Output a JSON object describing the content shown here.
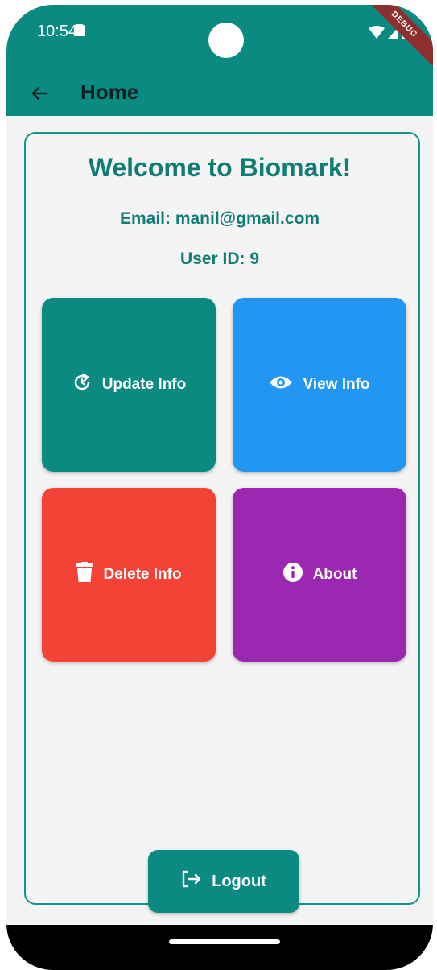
{
  "status_bar": {
    "time": "10:54",
    "debug_label": "DEBUG"
  },
  "app_bar": {
    "title": "Home"
  },
  "main": {
    "welcome": "Welcome to Biomark!",
    "email": "Email: manil@gmail.com",
    "user_id": "User ID: 9"
  },
  "tiles": {
    "update": {
      "label": "Update Info",
      "icon": "refresh-icon",
      "color": "#0b8a82"
    },
    "view": {
      "label": "View Info",
      "icon": "eye-icon",
      "color": "#2196f3"
    },
    "delete": {
      "label": "Delete Info",
      "icon": "trash-icon",
      "color": "#f44336"
    },
    "about": {
      "label": "About",
      "icon": "info-icon",
      "color": "#9c27b0"
    }
  },
  "logout": {
    "label": "Logout",
    "icon": "logout-icon"
  }
}
